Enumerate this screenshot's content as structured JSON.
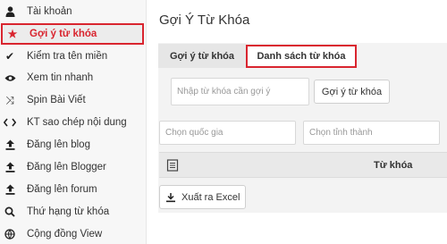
{
  "sidebar": {
    "items": [
      {
        "label": "Tài khoản",
        "icon": "user-icon"
      },
      {
        "label": "Gợi ý từ khóa",
        "icon": "star-icon",
        "active": true
      },
      {
        "label": "Kiểm tra tên miền",
        "icon": "check-icon"
      },
      {
        "label": "Xem tin nhanh",
        "icon": "eye-icon"
      },
      {
        "label": "Spin Bài Viết",
        "icon": "shuffle-icon"
      },
      {
        "label": "KT sao chép nội dung",
        "icon": "code-icon"
      },
      {
        "label": "Đăng lên blog",
        "icon": "upload-icon"
      },
      {
        "label": "Đăng lên Blogger",
        "icon": "upload-icon"
      },
      {
        "label": "Đăng lên forum",
        "icon": "upload-icon"
      },
      {
        "label": "Thứ hạng từ khóa",
        "icon": "search-icon"
      },
      {
        "label": "Cộng đồng View",
        "icon": "globe-icon"
      }
    ]
  },
  "main": {
    "title": "Gợi Ý Từ Khóa",
    "tabs": [
      {
        "label": "Gợi ý từ khóa"
      },
      {
        "label": "Danh sách từ khóa"
      }
    ],
    "keyword_input": {
      "placeholder": "Nhập từ khóa cần gợi ý",
      "value": ""
    },
    "suggest_button": "Gợi ý từ khóa",
    "country_input": {
      "placeholder": "Chọn quốc gia"
    },
    "city_input": {
      "placeholder": "Chọn tỉnh thành"
    },
    "table": {
      "header_keyword": "Từ khóa"
    },
    "export_button": "Xuất ra Excel"
  },
  "colors": {
    "accent": "#d9252f",
    "sidebar_bg": "#f7f7f7",
    "card_bg": "#f3f3f3"
  }
}
